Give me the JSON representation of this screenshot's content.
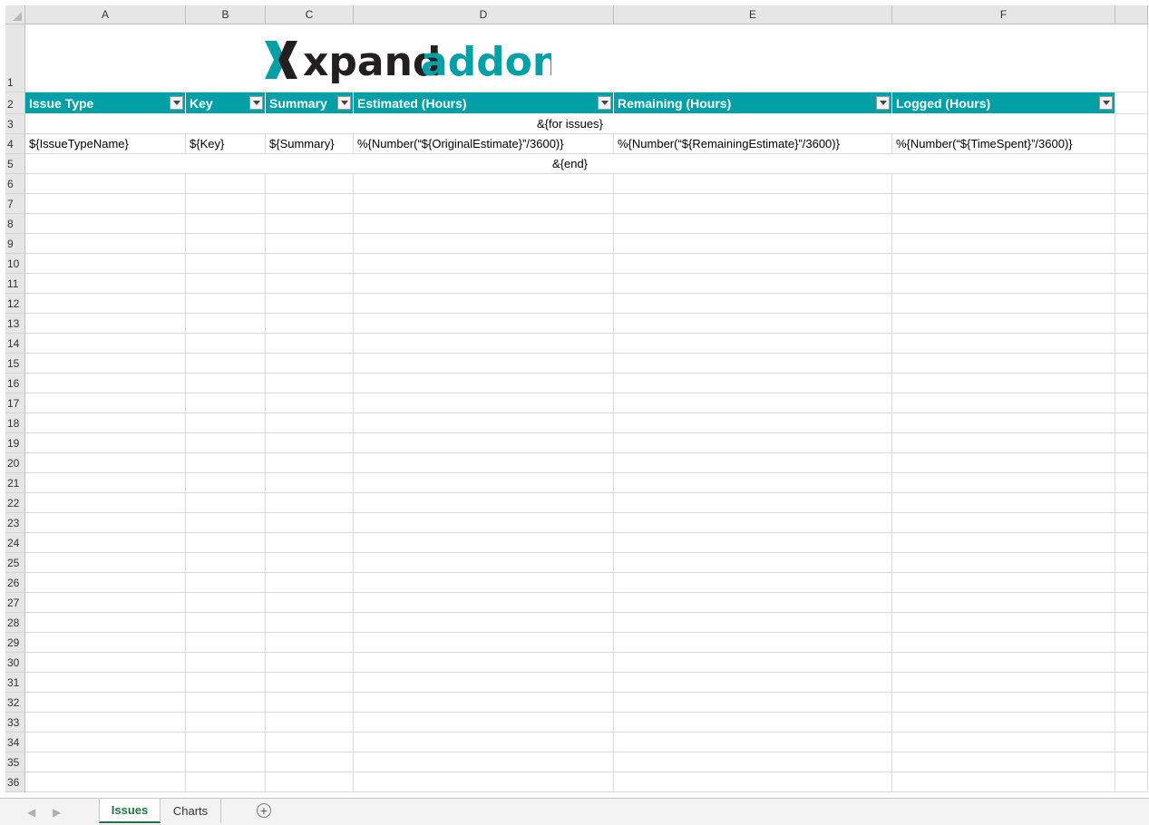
{
  "columns": [
    "A",
    "B",
    "C",
    "D",
    "E",
    "F"
  ],
  "row_numbers": [
    "1",
    "2",
    "3",
    "4",
    "5",
    "6",
    "7",
    "8",
    "9",
    "10",
    "11",
    "12",
    "13",
    "14",
    "15",
    "16",
    "17",
    "18",
    "19",
    "20",
    "21",
    "22",
    "23",
    "24",
    "25",
    "26",
    "27",
    "28",
    "29",
    "30",
    "31",
    "32",
    "33",
    "34",
    "35",
    "36"
  ],
  "logo": {
    "part1": "xpand",
    "part2": "addons"
  },
  "header": [
    "Issue Type",
    "Key",
    "Summary",
    "Estimated (Hours)",
    "Remaining (Hours)",
    "Logged (Hours)"
  ],
  "row3_text": "&{for issues}",
  "row4": [
    "${IssueTypeName}",
    "${Key}",
    "${Summary}",
    "%{Number(“${OriginalEstimate}”/3600)}",
    "%{Number(“${RemainingEstimate}”/3600)}",
    "%{Number(“${TimeSpent}”/3600)}"
  ],
  "row5_text": "&{end}",
  "sheet_tabs": [
    {
      "label": "Issues",
      "active": true
    },
    {
      "label": "Charts",
      "active": false
    }
  ],
  "colors": {
    "header_bg": "#00a0a6",
    "logo_dark": "#231f20",
    "logo_teal": "#00a0a6",
    "active_tab": "#217346"
  },
  "icons": {
    "add_sheet": "plus-circle-icon",
    "filter": "dropdown-arrow-icon",
    "nav_prev": "triangle-left-icon",
    "nav_next": "triangle-right-icon"
  }
}
